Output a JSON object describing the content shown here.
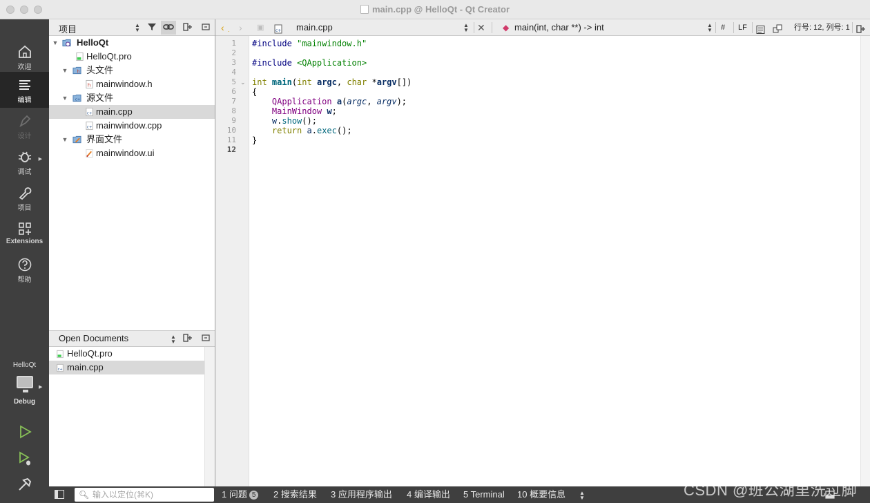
{
  "window": {
    "title": "main.cpp @ HelloQt - Qt Creator"
  },
  "modes": [
    {
      "label": "欢迎",
      "icon": "home-icon",
      "state": "normal"
    },
    {
      "label": "编辑",
      "icon": "edit-icon",
      "state": "active"
    },
    {
      "label": "设计",
      "icon": "design-icon",
      "state": "disabled"
    },
    {
      "label": "调试",
      "icon": "bug-icon",
      "state": "normal"
    },
    {
      "label": "项目",
      "icon": "wrench-icon",
      "state": "normal"
    },
    {
      "label": "Extensions",
      "icon": "extensions-icon",
      "state": "normal"
    },
    {
      "label": "帮助",
      "icon": "help-icon",
      "state": "normal"
    }
  ],
  "kit": {
    "project": "HelloQt",
    "build": "Debug"
  },
  "projects": {
    "title": "项目",
    "tree": [
      {
        "label": "HelloQt",
        "type": "project"
      },
      {
        "label": "HelloQt.pro",
        "type": "pro"
      },
      {
        "label": "头文件",
        "type": "folder"
      },
      {
        "label": "mainwindow.h",
        "type": "header"
      },
      {
        "label": "源文件",
        "type": "folder"
      },
      {
        "label": "main.cpp",
        "type": "cpp",
        "selected": true
      },
      {
        "label": "mainwindow.cpp",
        "type": "cpp"
      },
      {
        "label": "界面文件",
        "type": "folder"
      },
      {
        "label": "mainwindow.ui",
        "type": "ui"
      }
    ]
  },
  "open_documents": {
    "title": "Open Documents",
    "items": [
      {
        "label": "HelloQt.pro",
        "type": "pro"
      },
      {
        "label": "main.cpp",
        "type": "cpp",
        "selected": true
      }
    ]
  },
  "editor": {
    "file": "main.cpp",
    "symbol": "main(int, char **) -> int",
    "line_ending": "LF",
    "hash": "#",
    "position": "行号: 12, 列号: 1",
    "current_line": 12,
    "lines": [
      "#include \"mainwindow.h\"",
      "",
      "#include <QApplication>",
      "",
      "int main(int argc, char *argv[])",
      "{",
      "    QApplication a(argc, argv);",
      "    MainWindow w;",
      "    w.show();",
      "    return a.exec();",
      "}",
      ""
    ]
  },
  "statusbar": {
    "locator_placeholder": "输入以定位(⌘K)",
    "panes": [
      {
        "num": "1",
        "label": "问题",
        "badge": "5"
      },
      {
        "num": "2",
        "label": "搜索结果"
      },
      {
        "num": "3",
        "label": "应用程序输出"
      },
      {
        "num": "4",
        "label": "编译输出"
      },
      {
        "num": "5",
        "label": "Terminal"
      },
      {
        "num": "10",
        "label": "概要信息"
      }
    ]
  },
  "watermark": "CSDN @班公湖里洗过脚",
  "colors": {
    "modebar": "#3f3f3f",
    "keyword": "#808000",
    "string": "#008000",
    "preprocessor": "#000080",
    "type": "#800080"
  }
}
